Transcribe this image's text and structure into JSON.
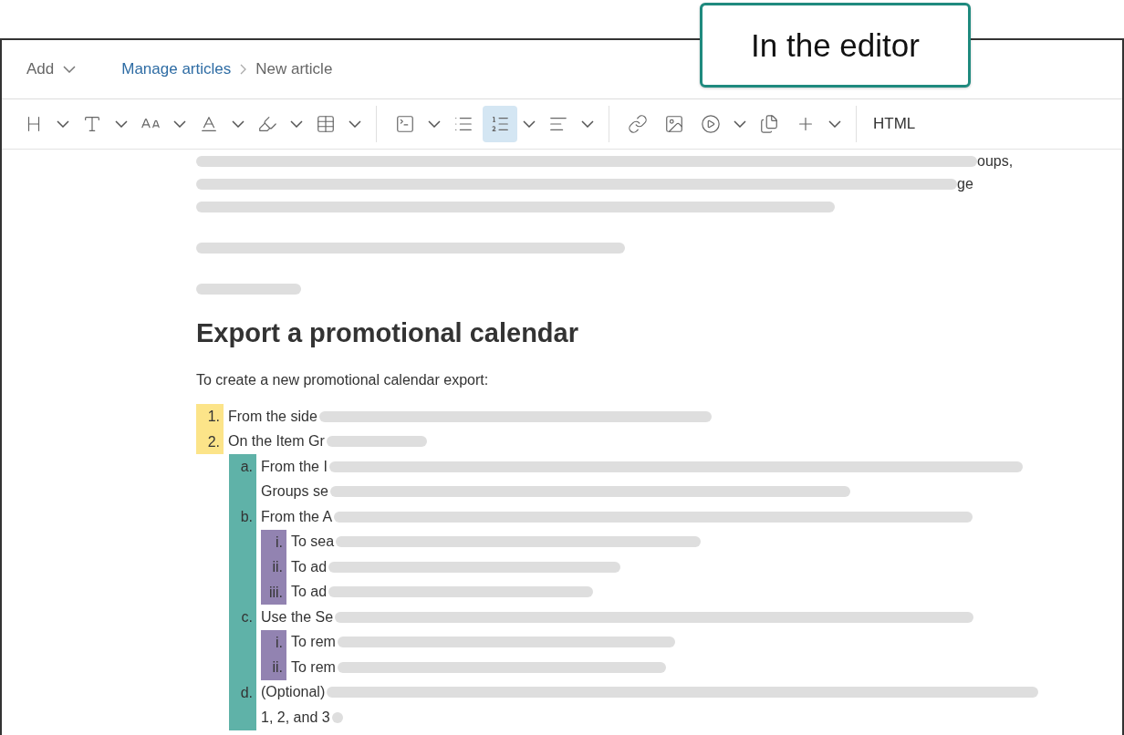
{
  "callout": {
    "text": "In the editor"
  },
  "header": {
    "add_menu": "Add",
    "breadcrumb": [
      {
        "label": "Manage articles",
        "kind": "link"
      },
      {
        "label": "New article",
        "kind": "current"
      }
    ]
  },
  "toolbar": {
    "groups": [
      {
        "items": [
          {
            "kind": "heading",
            "dropdown": true,
            "selected": false
          },
          {
            "kind": "text",
            "dropdown": true,
            "selected": false
          },
          {
            "kind": "size",
            "dropdown": true,
            "selected": false
          },
          {
            "kind": "color",
            "dropdown": true,
            "selected": false
          },
          {
            "kind": "highlight",
            "dropdown": true,
            "selected": false
          },
          {
            "kind": "table",
            "dropdown": true,
            "selected": false
          }
        ]
      },
      {
        "items": [
          {
            "kind": "code",
            "dropdown": true,
            "selected": false
          },
          {
            "kind": "bullets",
            "dropdown": false,
            "selected": false
          },
          {
            "kind": "numbers",
            "dropdown": true,
            "selected": true
          },
          {
            "kind": "align",
            "dropdown": true,
            "selected": false
          }
        ]
      },
      {
        "items": [
          {
            "kind": "link",
            "dropdown": false,
            "selected": false
          },
          {
            "kind": "image",
            "dropdown": false,
            "selected": false
          },
          {
            "kind": "video",
            "dropdown": true,
            "selected": false
          },
          {
            "kind": "copy",
            "dropdown": false,
            "selected": false
          },
          {
            "kind": "insert",
            "dropdown": true,
            "selected": false
          }
        ]
      }
    ],
    "html_button": "HTML"
  },
  "document": {
    "intro": [
      {
        "lines": [
          {
            "text": "oups,",
            "blur_before": true,
            "blur_after": false
          },
          {
            "text": "ge",
            "blur_before": true,
            "blur_after": false
          },
          {
            "blur_before": true,
            "blur_after": false
          }
        ]
      },
      {
        "lines": [
          {
            "blur_before": true,
            "blur_after": false
          }
        ]
      },
      {
        "lines": [
          {
            "blur_before": true,
            "blur_after": false
          }
        ]
      }
    ],
    "heading": "Export a promotional calendar",
    "lead": "To create a new promotional calendar export:",
    "list": [
      {
        "marker": "1.",
        "lines": [
          {
            "text": "From the side",
            "blur_before": false,
            "blur_after": true
          }
        ]
      },
      {
        "marker": "2.",
        "lines": [
          {
            "text": "On the Item Gr",
            "blur_before": false,
            "blur_after": true
          }
        ],
        "children": [
          {
            "marker": "a.",
            "lines": [
              {
                "text": "From the I",
                "blur_before": false,
                "blur_after": true
              },
              {
                "text": "Groups se",
                "blur_before": false,
                "blur_after": true
              }
            ]
          },
          {
            "marker": "b.",
            "lines": [
              {
                "text": "From the A",
                "blur_before": false,
                "blur_after": true
              }
            ],
            "children": [
              {
                "marker": "i.",
                "lines": [
                  {
                    "text": "To sea",
                    "blur_before": false,
                    "blur_after": true
                  }
                ]
              },
              {
                "marker": "ii.",
                "lines": [
                  {
                    "text": "To ad",
                    "blur_before": false,
                    "blur_after": true
                  }
                ]
              },
              {
                "marker": "iii.",
                "lines": [
                  {
                    "text": "To ad",
                    "blur_before": false,
                    "blur_after": true
                  }
                ]
              }
            ]
          },
          {
            "marker": "c.",
            "lines": [
              {
                "text": "Use the Se",
                "blur_before": false,
                "blur_after": true
              }
            ],
            "children": [
              {
                "marker": "i.",
                "lines": [
                  {
                    "text": "To rem",
                    "blur_before": false,
                    "blur_after": true
                  }
                ]
              },
              {
                "marker": "ii.",
                "lines": [
                  {
                    "text": "To rem",
                    "blur_before": false,
                    "blur_after": true
                  }
                ]
              }
            ]
          },
          {
            "marker": "d.",
            "lines": [
              {
                "text": "(Optional)",
                "blur_before": false,
                "blur_after": true
              },
              {
                "text": "1, 2, and 3",
                "blur_before": false,
                "blur_after": true
              }
            ]
          }
        ]
      }
    ]
  }
}
